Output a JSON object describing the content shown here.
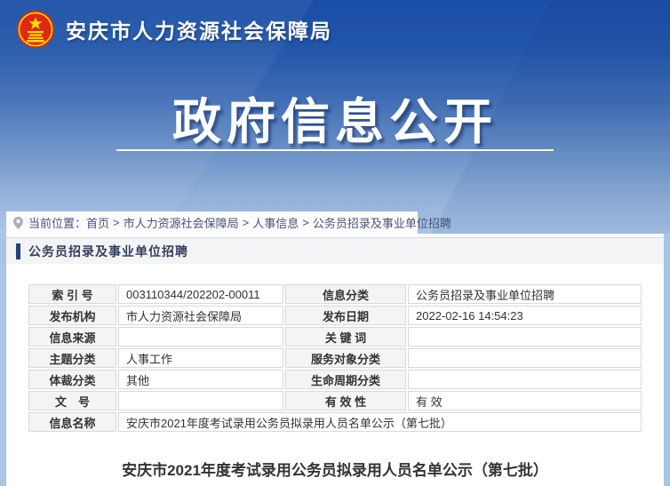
{
  "colors": {
    "header_gradient_top": "#1b4ea6",
    "header_gradient_bottom": "#a9c4e6",
    "page_background": "#a9c4e5",
    "section_accent": "#24407c",
    "label_cell_bg": "#f4f4f4",
    "emblem_red": "#de2910",
    "emblem_yellow": "#ffde00"
  },
  "header": {
    "emblem_icon": "china-national-emblem",
    "site_name": "安庆市人力资源社会保障局",
    "banner_title": "政府信息公开"
  },
  "breadcrumb": {
    "location_icon": "location-pin",
    "label": "当前位置：",
    "separator": ">",
    "items": [
      "首页",
      "市人力资源社会保障局",
      "人事信息",
      "公务员招录及事业单位招聘"
    ]
  },
  "section": {
    "title": "公务员招录及事业单位招聘"
  },
  "info_table": {
    "rows": [
      {
        "label1": "索 引 号",
        "value1": "003110344/202202-00011",
        "label2": "信息分类",
        "value2": "公务员招录及事业单位招聘"
      },
      {
        "label1": "发布机构",
        "value1": "市人力资源社会保障局",
        "label2": "发布日期",
        "value2": "2022-02-16 14:54:23"
      },
      {
        "label1": "信息来源",
        "value1": "",
        "label2": "关 键 词",
        "value2": ""
      },
      {
        "label1": "主题分类",
        "value1": "人事工作",
        "label2": "服务对象分类",
        "value2": ""
      },
      {
        "label1": "体裁分类",
        "value1": "其他",
        "label2": "生命周期分类",
        "value2": ""
      },
      {
        "label1": "文　号",
        "value1": "",
        "label2": "有 效 性",
        "value2": "有 效"
      }
    ],
    "name_row": {
      "label": "信息名称",
      "value": "安庆市2021年度考试录用公务员拟录用人员名单公示（第七批）"
    }
  },
  "article": {
    "title": "安庆市2021年度考试录用公务员拟录用人员名单公示（第七批）"
  }
}
